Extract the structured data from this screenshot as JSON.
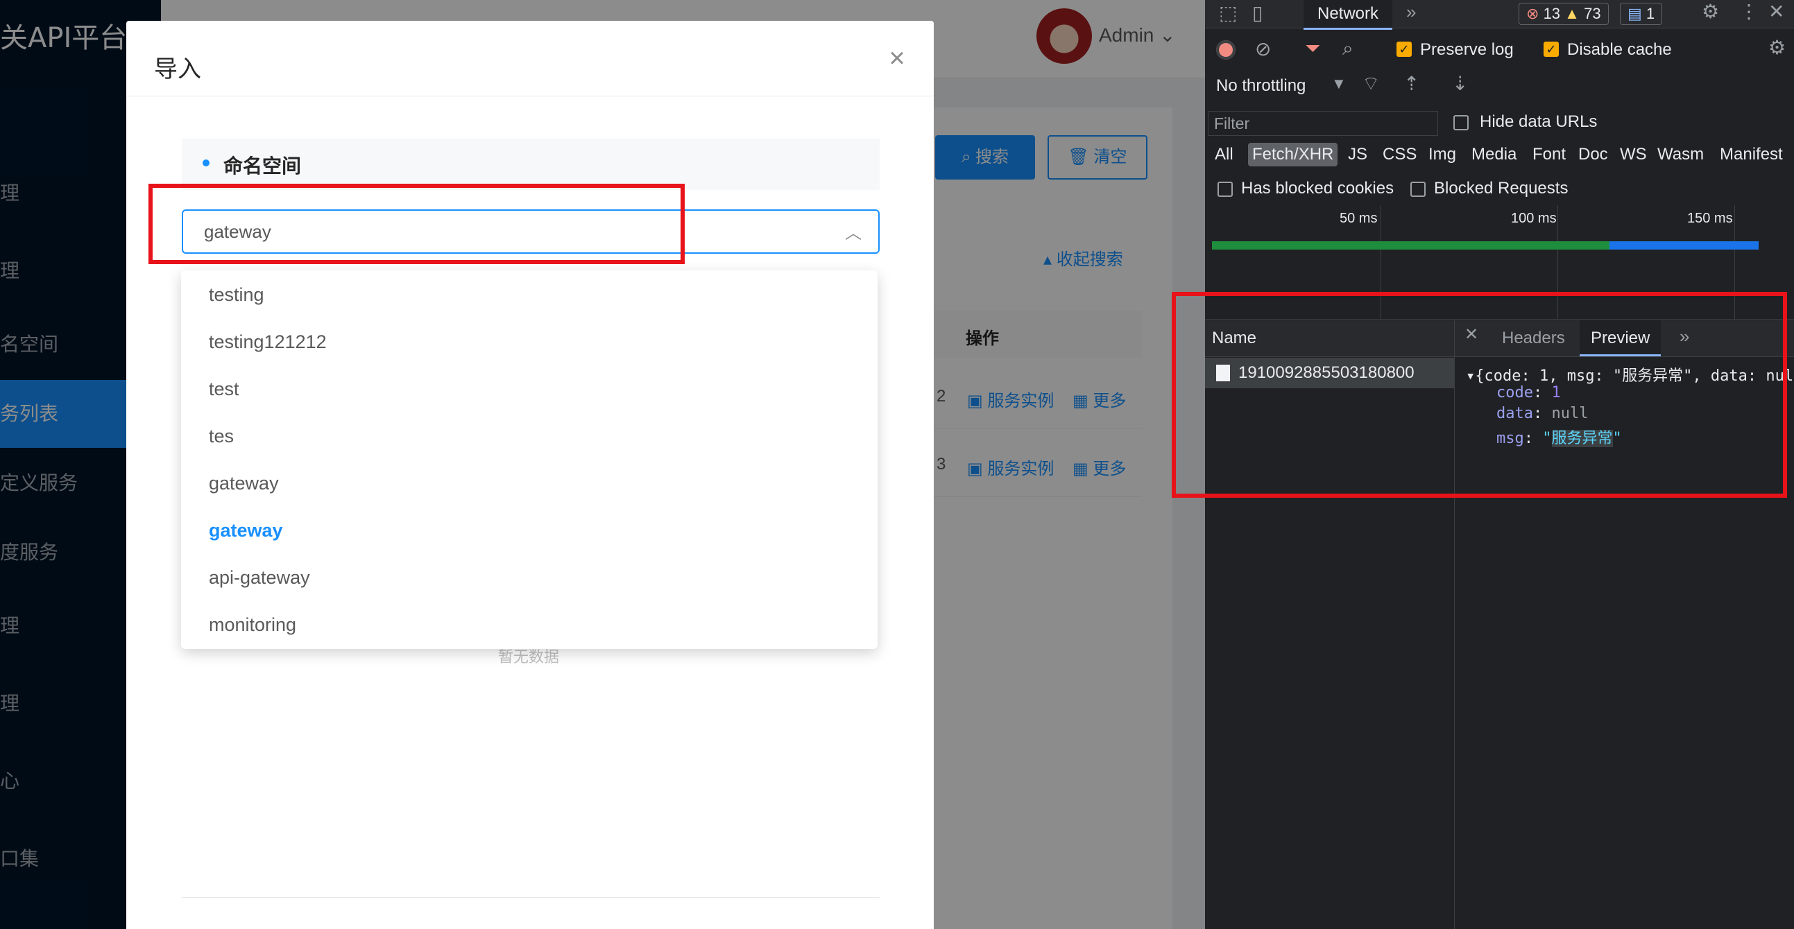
{
  "background_app": {
    "platform_title": "关API平台",
    "sidebar_items": [
      {
        "label": "理",
        "chevron": "⌄"
      },
      {
        "label": "理",
        "chevron": "⌃"
      },
      {
        "label": "名空间",
        "chevron": ""
      },
      {
        "label": "务列表",
        "chevron": ""
      },
      {
        "label": "定义服务",
        "chevron": ""
      },
      {
        "label": "度服务",
        "chevron": ""
      },
      {
        "label": "理",
        "chevron": "⌄"
      },
      {
        "label": "理",
        "chevron": "⌄"
      },
      {
        "label": "心",
        "chevron": "⌄"
      },
      {
        "label": "口集",
        "chevron": "⌄"
      }
    ],
    "user": "Admin",
    "search_button": "搜索",
    "clear_button": "清空",
    "collapse_search": "收起搜索",
    "table_header_actions": "操作",
    "rows": [
      {
        "frag": "2",
        "instance_link": "服务实例",
        "more_link": "更多"
      },
      {
        "frag": "3",
        "instance_link": "服务实例",
        "more_link": "更多"
      }
    ]
  },
  "modal": {
    "title": "导入",
    "close_icon": "×",
    "section_label": "命名空间",
    "select_value": "gateway",
    "empty_text": "暂无数据",
    "dropdown_options": [
      {
        "label": "testing",
        "selected": false
      },
      {
        "label": "testing121212",
        "selected": false
      },
      {
        "label": "test",
        "selected": false
      },
      {
        "label": "tes",
        "selected": false
      },
      {
        "label": "gateway",
        "selected": false
      },
      {
        "label": "gateway",
        "selected": true
      },
      {
        "label": "api-gateway",
        "selected": false
      },
      {
        "label": "monitoring",
        "selected": false
      }
    ]
  },
  "devtools": {
    "panel_tab": "Network",
    "errors": "13",
    "warnings": "73",
    "messages": "1",
    "preserve_log": "Preserve log",
    "preserve_log_checked": true,
    "disable_cache": "Disable cache",
    "disable_cache_checked": true,
    "throttling": "No throttling",
    "filter_placeholder": "Filter",
    "hide_data_urls": "Hide data URLs",
    "types": [
      "All",
      "Fetch/XHR",
      "JS",
      "CSS",
      "Img",
      "Media",
      "Font",
      "Doc",
      "WS",
      "Wasm",
      "Manifest"
    ],
    "active_type": "Fetch/XHR",
    "has_blocked_cookies": "Has blocked cookies",
    "blocked_requests": "Blocked Requests",
    "timeline_ticks": [
      "50 ms",
      "100 ms",
      "150 ms"
    ],
    "name_column": "Name",
    "request_name": "1910092885503180800",
    "detail_tabs": [
      "Headers",
      "Preview"
    ],
    "active_detail_tab": "Preview",
    "preview": {
      "summary": "{code: 1, msg: \"服务异常\", data: nul",
      "code_key": "code",
      "code_value": "1",
      "data_key": "data",
      "data_value": "null",
      "msg_key": "msg",
      "msg_value": "服务异常"
    }
  },
  "colors": {
    "primary": "#1890ff",
    "annotation_red": "#e8131a",
    "devtools_bg": "#202124"
  }
}
